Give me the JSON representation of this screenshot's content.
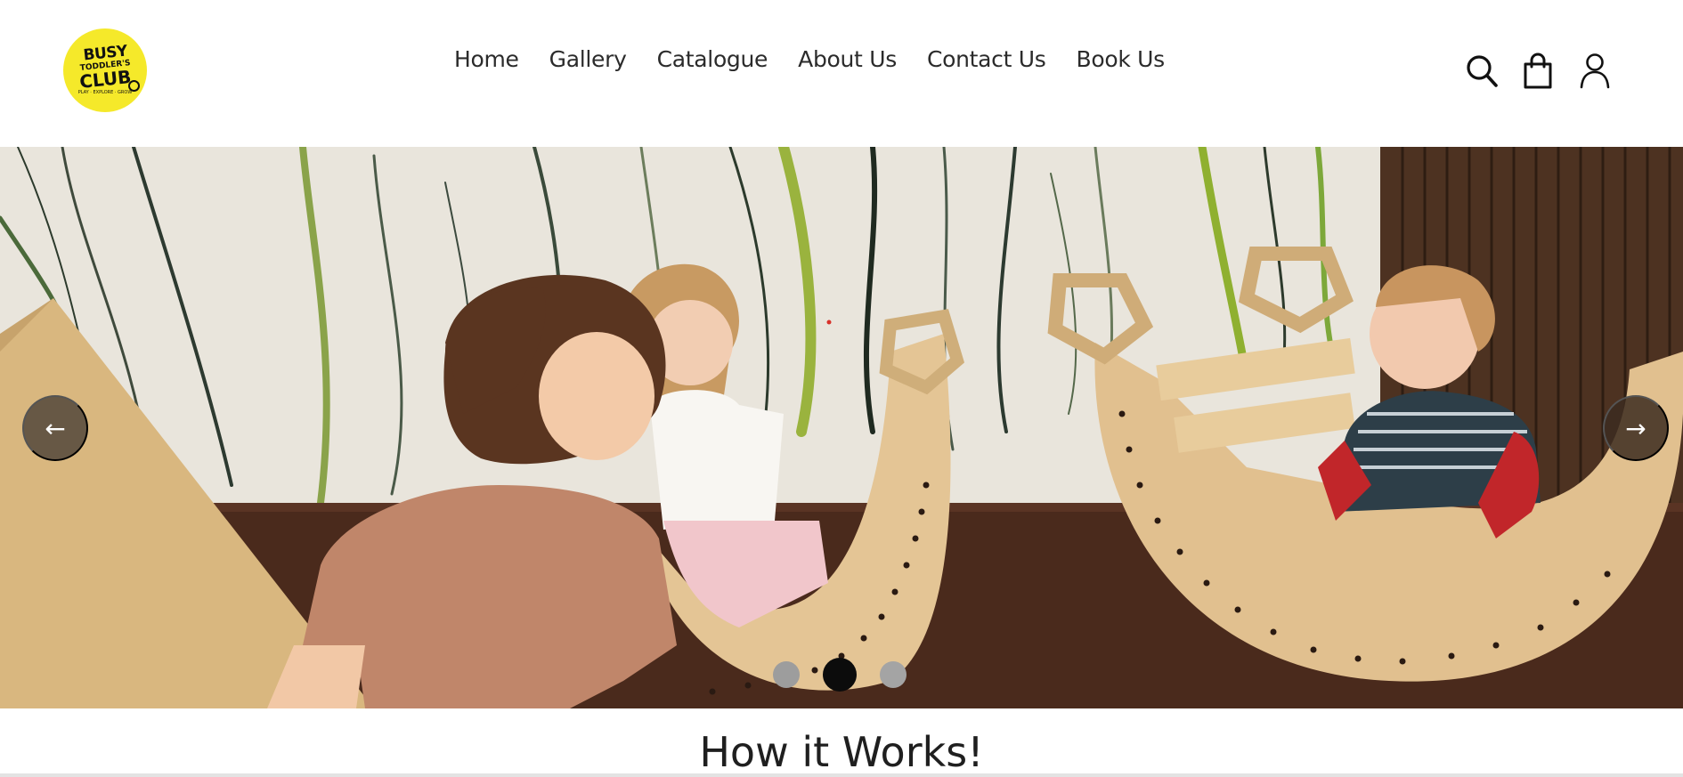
{
  "logo": {
    "line1": "BUSY",
    "line2": "TODDLER'S",
    "line3": "CLUB",
    "tagline": "PLAY · EXPLORE · GROW",
    "color": "#f5e92a"
  },
  "nav": {
    "items": [
      {
        "label": "Home"
      },
      {
        "label": "Gallery"
      },
      {
        "label": "Catalogue"
      },
      {
        "label": "About Us"
      },
      {
        "label": "Contact Us"
      },
      {
        "label": "Book Us"
      }
    ]
  },
  "header_icons": [
    "search-icon",
    "shopping-bag-icon",
    "user-icon"
  ],
  "slider": {
    "prev_label": "←",
    "next_label": "→",
    "slide_count": 3,
    "active_slide": 2,
    "image_alt": "Children playing on wooden rocking climbers"
  },
  "section": {
    "title": "How it Works!"
  }
}
